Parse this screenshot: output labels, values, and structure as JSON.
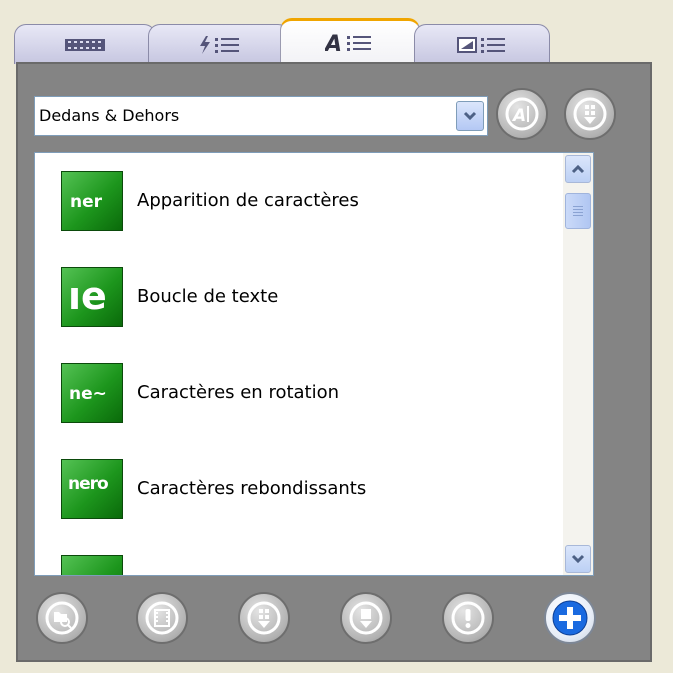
{
  "tabs": [
    {
      "name": "film-strip-icon",
      "active": false
    },
    {
      "name": "effects-list-icon",
      "active": false
    },
    {
      "name": "text-list-icon",
      "active": true
    },
    {
      "name": "transitions-list-icon",
      "active": false
    }
  ],
  "dropdown": {
    "selected": "Dedans & Dehors"
  },
  "list": {
    "items": [
      {
        "label": "Apparition de caractères",
        "icon_text": "ner"
      },
      {
        "label": "Boucle de texte",
        "icon_text": "ıe"
      },
      {
        "label": "Caractères en rotation",
        "icon_text": "ne~"
      },
      {
        "label": "Caractères rebondissants",
        "icon_text": "nero"
      }
    ]
  },
  "colors": {
    "panel": "#848484",
    "accent_tab": "#f0a500",
    "icon_green": "#1d961d",
    "accent_blue": "#1a6ae0"
  }
}
